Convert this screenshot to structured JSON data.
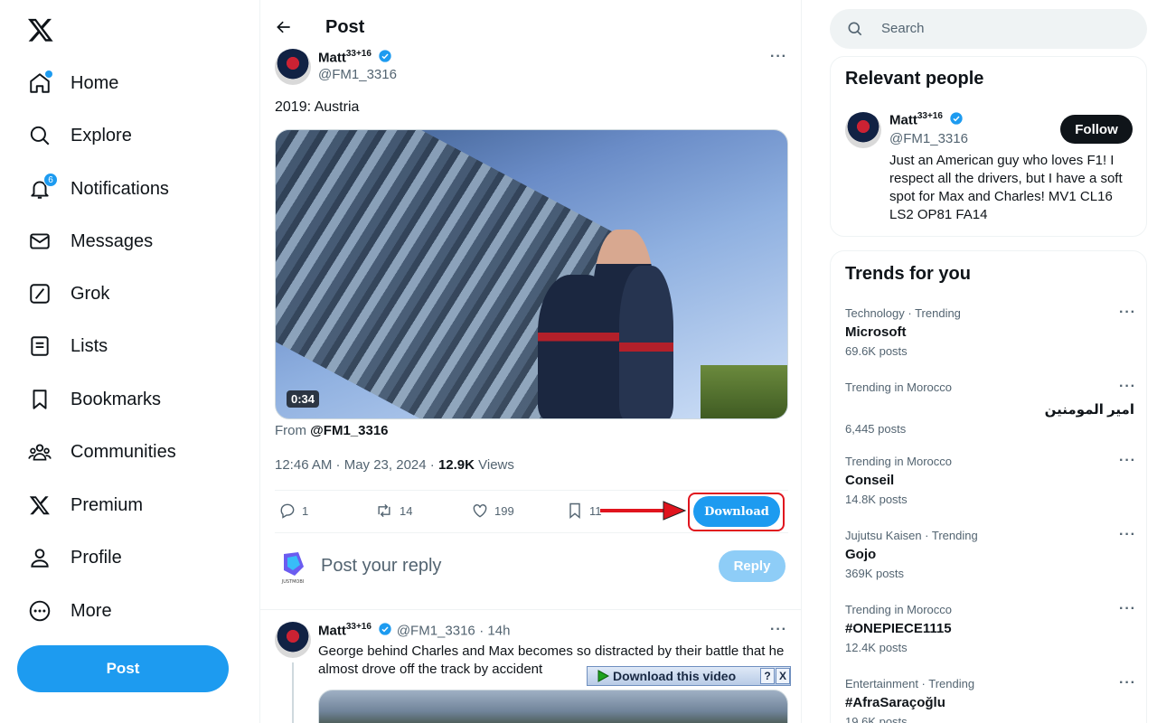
{
  "nav": {
    "logo": "x-logo",
    "items": [
      {
        "label": "Home",
        "icon": "home-icon"
      },
      {
        "label": "Explore",
        "icon": "search-icon"
      },
      {
        "label": "Notifications",
        "icon": "bell-icon",
        "badge": "6"
      },
      {
        "label": "Messages",
        "icon": "mail-icon"
      },
      {
        "label": "Grok",
        "icon": "grok-icon"
      },
      {
        "label": "Lists",
        "icon": "list-icon"
      },
      {
        "label": "Bookmarks",
        "icon": "bookmark-icon"
      },
      {
        "label": "Communities",
        "icon": "people-icon"
      },
      {
        "label": "Premium",
        "icon": "x-icon"
      },
      {
        "label": "Profile",
        "icon": "person-icon"
      },
      {
        "label": "More",
        "icon": "more-circle-icon"
      }
    ],
    "post_button": "Post"
  },
  "header": {
    "title": "Post"
  },
  "tweet": {
    "name": "Matt",
    "name_sup": "33+16",
    "handle": "@FM1_3316",
    "text": "2019: Austria",
    "video_duration": "0:34",
    "from_label": "From",
    "from_handle": "@FM1_3316",
    "timestamp": "12:46 AM · May 23, 2024 · ",
    "views_count": "12.9K",
    "views_label": "Views",
    "replies": "1",
    "retweets": "14",
    "likes": "199",
    "bookmarks": "11",
    "download_label": "Download"
  },
  "reply_box": {
    "placeholder": "Post your reply",
    "button": "Reply",
    "avatar_text": "JUSTMOBI"
  },
  "reply_tweet": {
    "name": "Matt",
    "name_sup": "33+16",
    "handle": "@FM1_3316",
    "time": "· 14h",
    "text": "George behind Charles and Max becomes so distracted by their battle that he almost drove off the track by accident",
    "download_video": "Download this video",
    "help": "?",
    "close": "X"
  },
  "search": {
    "placeholder": "Search"
  },
  "relevant_people": {
    "title": "Relevant people",
    "name": "Matt",
    "name_sup": "33+16",
    "handle": "@FM1_3316",
    "follow": "Follow",
    "bio": "Just an American guy who loves F1! I respect all the drivers, but I have a soft spot for Max and Charles! MV1 CL16 LS2 OP81 FA14"
  },
  "trends": {
    "title": "Trends for you",
    "items": [
      {
        "context": "Technology · Trending",
        "name": "Microsoft",
        "count": "69.6K posts"
      },
      {
        "context": "Trending in Morocco",
        "name": "امير المومنين",
        "count": "6,445 posts"
      },
      {
        "context": "Trending in Morocco",
        "name": "Conseil",
        "count": "14.8K posts"
      },
      {
        "context": "Jujutsu Kaisen · Trending",
        "name": "Gojo",
        "count": "369K posts"
      },
      {
        "context": "Trending in Morocco",
        "name": "#ONEPIECE1115",
        "count": "12.4K posts"
      },
      {
        "context": "Entertainment · Trending",
        "name": "#AfraSaraçoğlu",
        "count": "19.6K posts"
      }
    ]
  },
  "colors": {
    "accent": "#1d9bf0",
    "highlight": "#e0141e",
    "text": "#0f1419",
    "muted": "#536471"
  }
}
